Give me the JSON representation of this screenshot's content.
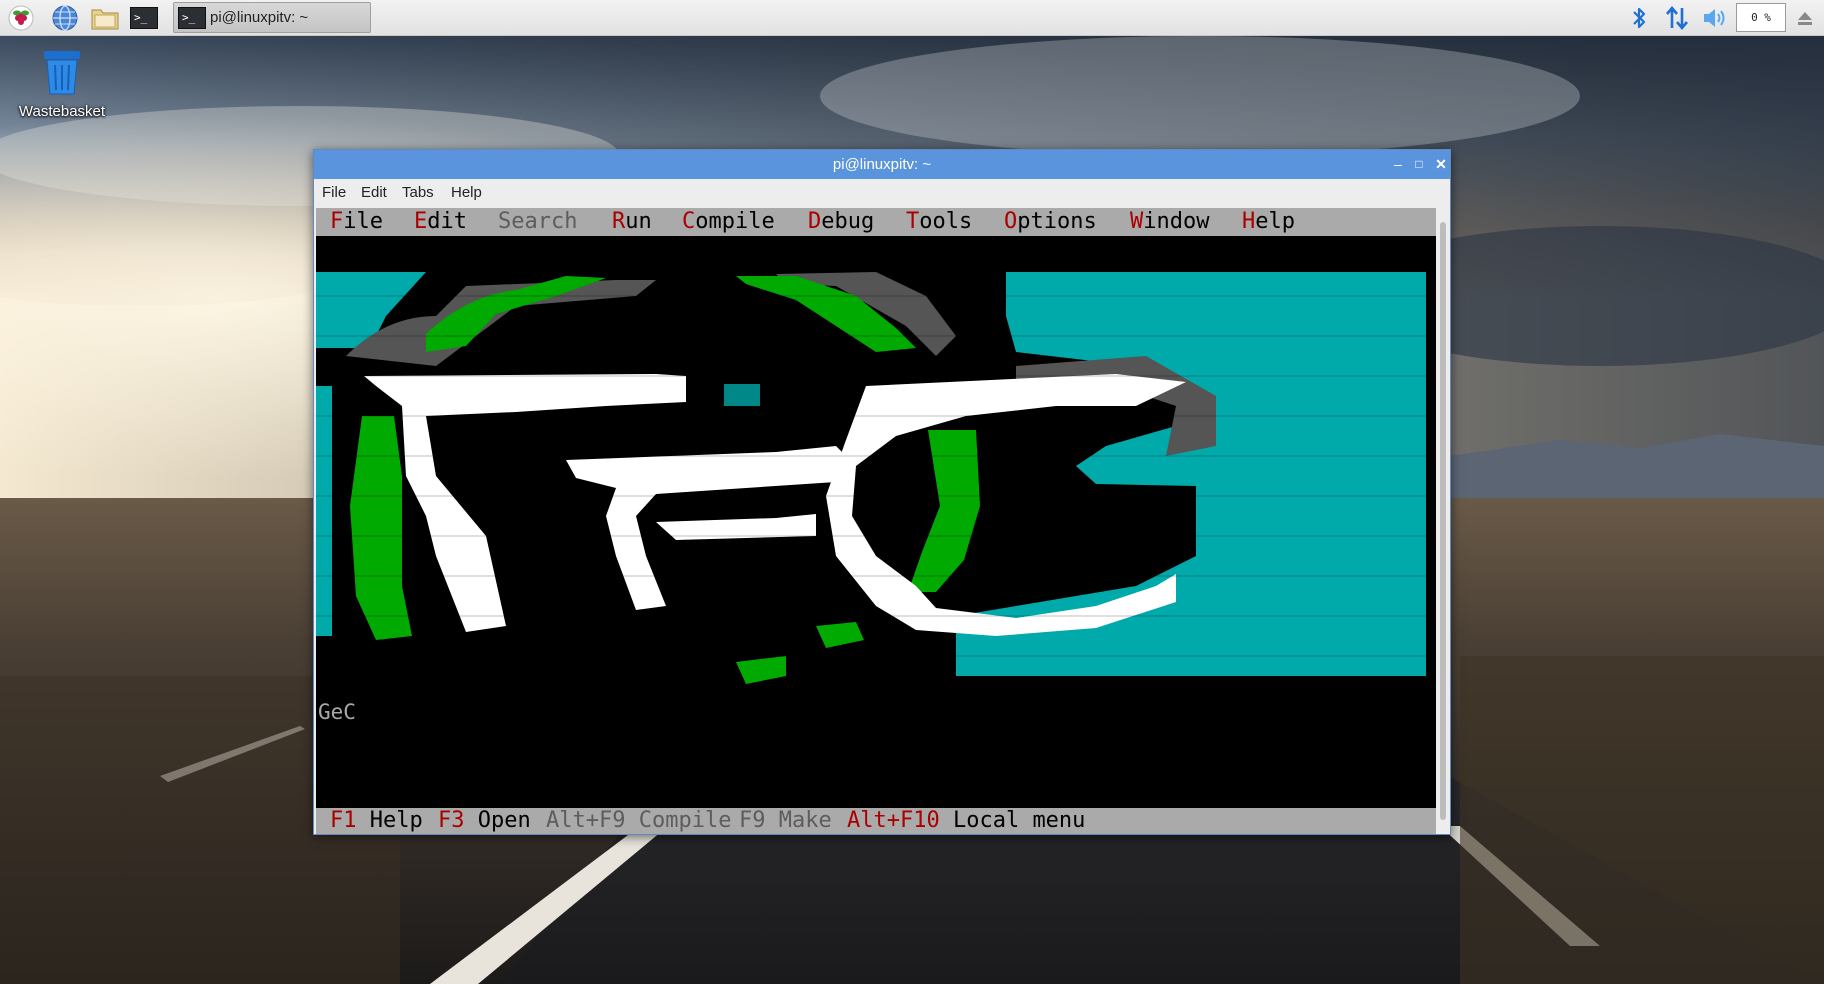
{
  "taskbar": {
    "task_label": "pi@linuxpitv: ~",
    "cpu_usage": "0 %",
    "icons": [
      "raspberry-menu-icon",
      "web-browser-icon",
      "file-manager-icon",
      "terminal-icon",
      "bluetooth-icon",
      "network-icon",
      "volume-icon",
      "eject-icon"
    ]
  },
  "desktop": {
    "wastebasket_label": "Wastebasket"
  },
  "window": {
    "title": "pi@linuxpitv: ~",
    "menu": {
      "file": "File",
      "edit": "Edit",
      "tabs": "Tabs",
      "help": "Help"
    }
  },
  "terminal": {
    "menu": [
      {
        "hot": "F",
        "rest": "ile",
        "disabled": false
      },
      {
        "hot": "E",
        "rest": "dit",
        "disabled": false
      },
      {
        "hot": "",
        "rest": "Search",
        "disabled": true
      },
      {
        "hot": "R",
        "rest": "un",
        "disabled": false
      },
      {
        "hot": "C",
        "rest": "ompile",
        "disabled": false
      },
      {
        "hot": "D",
        "rest": "ebug",
        "disabled": false
      },
      {
        "hot": "T",
        "rest": "ools",
        "disabled": false
      },
      {
        "hot": "O",
        "rest": "ptions",
        "disabled": false
      },
      {
        "hot": "W",
        "rest": "indow",
        "disabled": false
      },
      {
        "hot": "H",
        "rest": "elp",
        "disabled": false
      }
    ],
    "logo_caption": "GeC",
    "status": [
      {
        "key": "F1",
        "label": "Help",
        "disabled": false
      },
      {
        "key": "F3",
        "label": "Open",
        "disabled": false
      },
      {
        "key": "Alt+F9",
        "label": "Compile",
        "disabled": true
      },
      {
        "key": "F9",
        "label": "Make",
        "disabled": true
      },
      {
        "key": "Alt+F10",
        "label": "Local menu",
        "disabled": false
      }
    ]
  },
  "colors": {
    "titlebar": "#5a94dc",
    "turbo_gray": "#aaaaaa",
    "hotkey_red": "#aa0000",
    "logo_cyan": "#00aaaa",
    "logo_green": "#00aa00",
    "logo_white": "#ffffff"
  }
}
